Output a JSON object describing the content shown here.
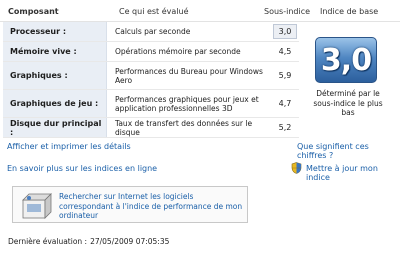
{
  "header": {
    "composant": "Composant",
    "evalue": "Ce qui est évalué",
    "sous_indice": "Sous-indice",
    "indice_base": "Indice de base"
  },
  "rows": [
    {
      "name": "Processeur :",
      "desc": "Calculs par seconde",
      "score": "3,0"
    },
    {
      "name": "Mémoire vive :",
      "desc": "Opérations mémoire par seconde",
      "score": "4,5"
    },
    {
      "name": "Graphiques :",
      "desc": "Performances du Bureau pour Windows Aero",
      "score": "5,9"
    },
    {
      "name": "Graphiques de jeu :",
      "desc": "Performances graphiques pour jeux et application professionnelles 3D",
      "score": "4,7"
    },
    {
      "name": "Disque dur principal :",
      "desc": "Taux de transfert des données sur le disque",
      "score": "5,2"
    }
  ],
  "base": {
    "score": "3,0",
    "caption": "Déterminé par le sous-indice le plus bas"
  },
  "links": {
    "print": "Afficher et imprimer les détails",
    "what": "Que signifient ces chiffres ?",
    "learn": "En savoir plus sur les indices en ligne",
    "update": "Mettre à jour mon indice"
  },
  "search": {
    "text": "Rechercher sur Internet les logiciels correspondant à l'indice de performance de mon ordinateur"
  },
  "last_eval": {
    "label": "Dernière évaluation :",
    "value": "27/05/2009 07:05:35"
  },
  "colors": {
    "link": "#1a5fa8",
    "badge_top": "#9bc3e8",
    "badge_bottom": "#2c5f9d"
  }
}
